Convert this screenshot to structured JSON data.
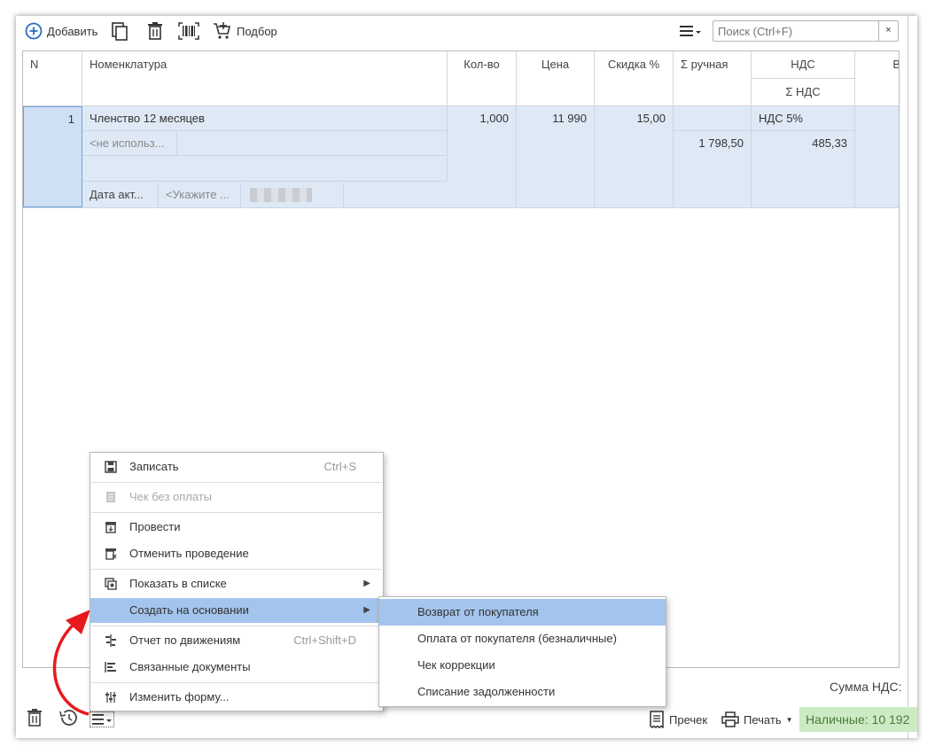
{
  "toolbar": {
    "add_label": "Добавить",
    "selection_label": "Подбор",
    "search_placeholder": "Поиск (Ctrl+F)",
    "clear_symbol": "×"
  },
  "table": {
    "columns": [
      "N",
      "Номенклатура",
      "Кол-во",
      "Цена",
      "Скидка %",
      "Σ ручная",
      "НДС",
      "Σ НДС",
      "В"
    ],
    "row": {
      "n": "1",
      "name": "Членство 12 месяцев",
      "qty": "1,000",
      "price": "11 990",
      "discount": "15,00",
      "manual_sum": "1 798,50",
      "vat_rate": "НДС 5%",
      "vat_sum": "485,33",
      "sub_unused": "<не использ...",
      "sub_date": "Дата акт...",
      "sub_specify": "<Укажите ..."
    }
  },
  "footer": {
    "vat_total_label": "Сумма НДС:",
    "precheck_label": "Пречек",
    "print_label": "Печать",
    "cash_label": "Наличные: 10 192"
  },
  "menu": {
    "items": [
      {
        "label": "Записать",
        "shortcut": "Ctrl+S"
      },
      {
        "label": "Чек без оплаты"
      },
      {
        "label": "Провести"
      },
      {
        "label": "Отменить проведение"
      },
      {
        "label": "Показать в списке"
      },
      {
        "label": "Создать на основании"
      },
      {
        "label": "Отчет по движениям",
        "shortcut": "Ctrl+Shift+D"
      },
      {
        "label": "Связанные документы"
      },
      {
        "label": "Изменить форму..."
      }
    ]
  },
  "submenu": {
    "items": [
      {
        "label": "Возврат от покупателя"
      },
      {
        "label": "Оплата от покупателя (безналичные)"
      },
      {
        "label": "Чек коррекции"
      },
      {
        "label": "Списание задолженности"
      }
    ]
  },
  "colors": {
    "selection": "#a3c4ec",
    "row_bg": "#dfe9f6",
    "cash_bg": "#ccebc4",
    "arrow": "#e8191c",
    "accent": "#2a6ebb"
  }
}
